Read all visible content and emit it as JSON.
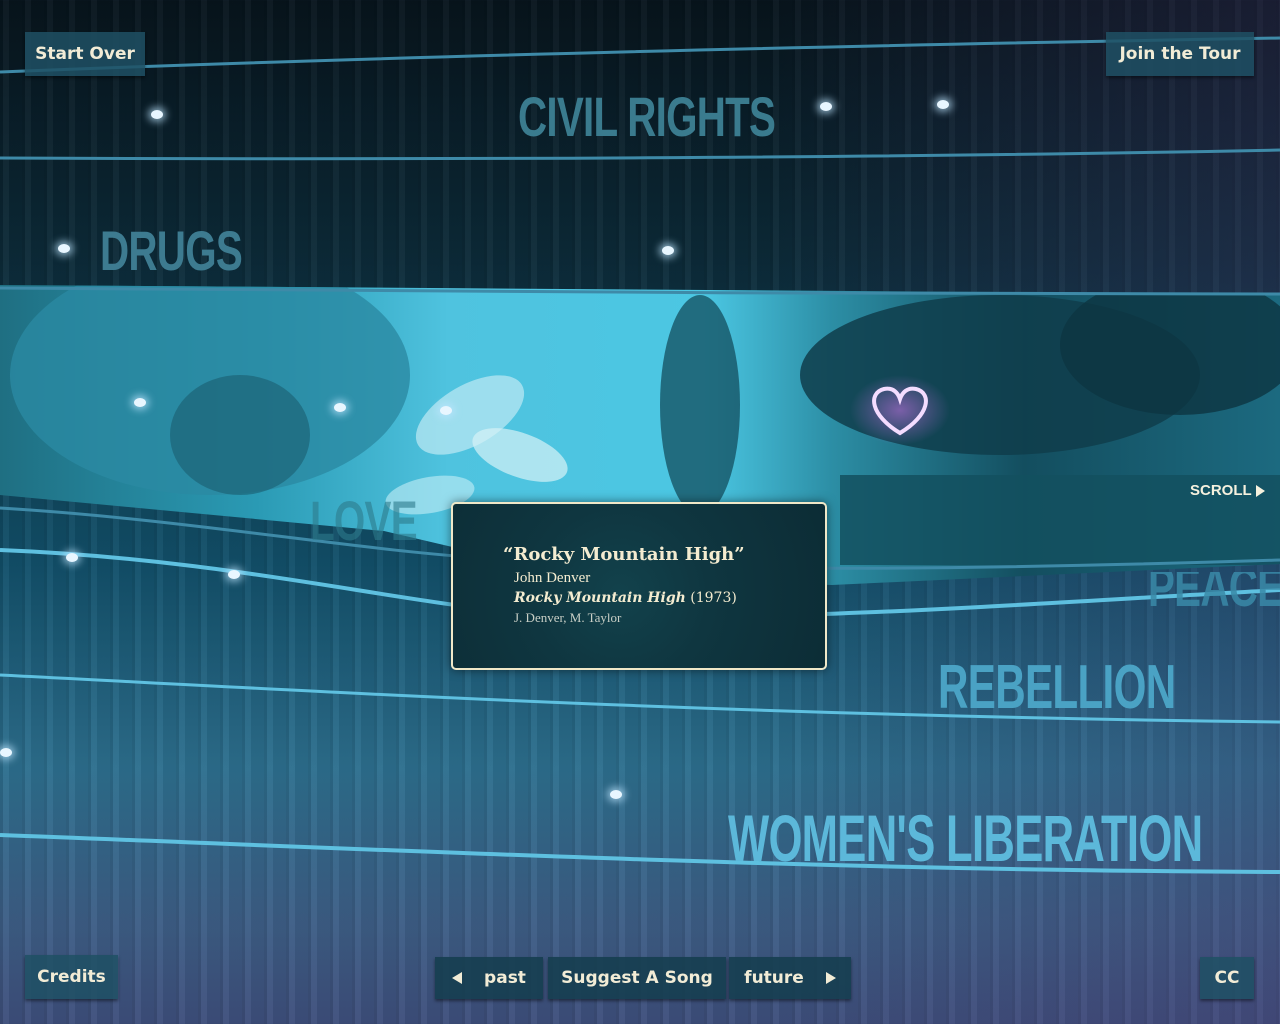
{
  "header": {
    "start_over_label": "Start Over",
    "join_tour_label": "Join the Tour"
  },
  "themes": {
    "civil_rights": "CIVIL RIGHTS",
    "drugs": "DRUGS",
    "love": "LOVE",
    "peace": "PEACE",
    "rebellion": "REBELLION",
    "womens_liberation": "WOMEN'S LIBERATION"
  },
  "song_popup": {
    "title": "“Rocky Mountain High”",
    "artist": "John Denver",
    "album": "Rocky Mountain High",
    "year": "(1973)",
    "writers": "J. Denver, M. Taylor"
  },
  "scroll_label": "SCROLL",
  "footer": {
    "credits_label": "Credits",
    "past_label": "past",
    "suggest_label": "Suggest A Song",
    "future_label": "future",
    "cc_label": "CC"
  },
  "colors": {
    "accent_text": "#f2ecd6",
    "theme_text": "#5fb6d4",
    "button_bg": "#1e5064"
  },
  "icons": [
    "heart-icon",
    "arrow-left-icon",
    "arrow-right-icon",
    "scroll-arrow-icon"
  ]
}
